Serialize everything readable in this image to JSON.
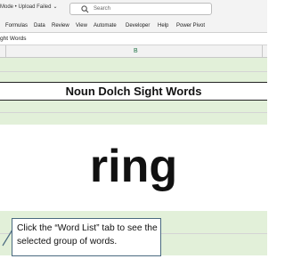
{
  "titlebar": {
    "status_text": "Mode • Upload Failed",
    "search_placeholder": "Search"
  },
  "ribbon": {
    "tabs": [
      "Formulas",
      "Data",
      "Review",
      "View",
      "Automate",
      "Developer",
      "Help",
      "Power Pivot"
    ]
  },
  "name_box": {
    "value": "ght Words"
  },
  "sheet": {
    "column_header": "B",
    "title": "Noun Dolch Sight Words",
    "word": "ring",
    "band_color": "#e2f0d9"
  },
  "callout": {
    "text": "Click the “Word List” tab to see the selected group of words."
  }
}
